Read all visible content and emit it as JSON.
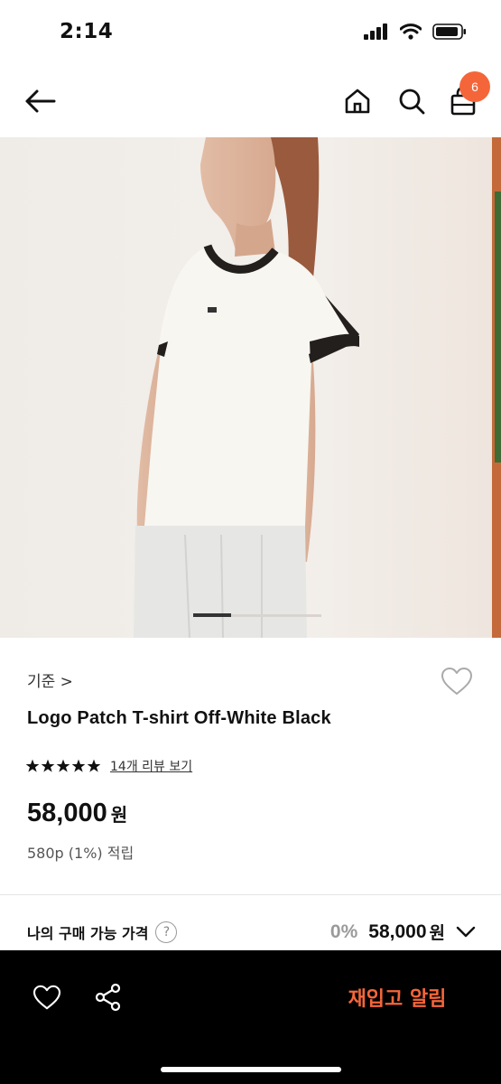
{
  "status_bar": {
    "time": "2:14"
  },
  "nav": {
    "cart_count": "6"
  },
  "product": {
    "brand": "기준 >",
    "title": "Logo Patch T-shirt Off-White Black",
    "rating_stars": 5,
    "review_link": "14개 리뷰 보기",
    "price": "58,000",
    "price_unit": "원",
    "points": "580p (1%) 적립"
  },
  "purchase_price": {
    "label": "나의 구매 가능 가격",
    "help": "?",
    "discount": "0%",
    "price": "58,000",
    "price_unit": "원"
  },
  "bottom_bar": {
    "restock_label": "재입고 알림"
  },
  "colors": {
    "accent": "#f4663a",
    "bottom_bar": "#000000"
  },
  "carousel": {
    "current_page": 1
  }
}
